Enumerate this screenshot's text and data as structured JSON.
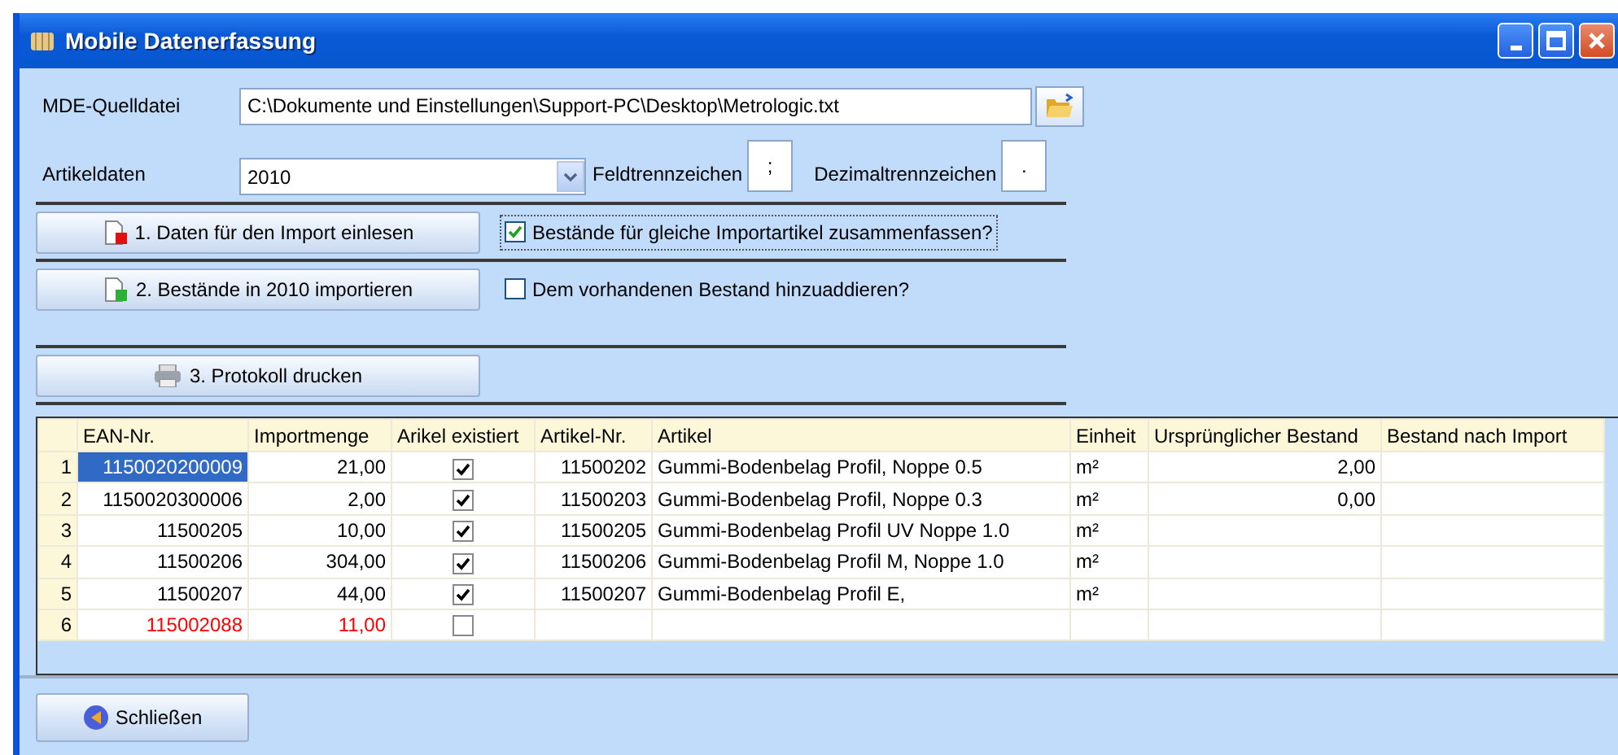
{
  "window": {
    "title": "Mobile Datenerfassung"
  },
  "source_file": {
    "label": "MDE-Quelldatei",
    "value": "C:\\Dokumente und Einstellungen\\Support-PC\\Desktop\\Metrologic.txt"
  },
  "article_data": {
    "label": "Artikeldaten",
    "value": "2010"
  },
  "field_separator": {
    "label": "Feldtrennzeichen",
    "value": ";"
  },
  "decimal_separator": {
    "label": "Dezimaltrennzeichen",
    "value": "."
  },
  "steps": [
    {
      "kind": "read",
      "label": "1. Daten für den Import einlesen",
      "option": {
        "label": "Bestände für gleiche Importartikel zusammenfassen?",
        "checked": true,
        "focused": true
      }
    },
    {
      "kind": "import",
      "label": "2. Bestände in 2010 importieren",
      "option": {
        "label": "Dem vorhandenen Bestand hinzuaddieren?",
        "checked": false,
        "focused": false
      }
    },
    {
      "kind": "print",
      "label": "3. Protokoll drucken"
    }
  ],
  "table": {
    "columns": [
      "EAN-Nr.",
      "Importmenge",
      "Arikel existiert",
      "Artikel-Nr.",
      "Artikel",
      "Einheit",
      "Ursprünglicher Bestand",
      "Bestand nach Import"
    ],
    "rows": [
      {
        "number": "1",
        "ean": "1150020200009",
        "quantity": "21,00",
        "exists": true,
        "article_no": "11500202",
        "article": "Gummi-Bodenbelag Profil, Noppe 0.5",
        "unit": "m²",
        "original_stock": "2,00",
        "selected": true,
        "invalid": false
      },
      {
        "number": "2",
        "ean": "1150020300006",
        "quantity": "2,00",
        "exists": true,
        "article_no": "11500203",
        "article": "Gummi-Bodenbelag Profil, Noppe 0.3",
        "unit": "m²",
        "original_stock": "0,00",
        "selected": false,
        "invalid": false
      },
      {
        "number": "3",
        "ean": "11500205",
        "quantity": "10,00",
        "exists": true,
        "article_no": "11500205",
        "article": "Gummi-Bodenbelag Profil UV Noppe 1.0",
        "unit": "m²",
        "selected": false,
        "invalid": false
      },
      {
        "number": "4",
        "ean": "11500206",
        "quantity": "304,00",
        "exists": true,
        "article_no": "11500206",
        "article": "Gummi-Bodenbelag Profil M, Noppe 1.0",
        "unit": "m²",
        "selected": false,
        "invalid": false
      },
      {
        "number": "5",
        "ean": "11500207",
        "quantity": "44,00",
        "exists": true,
        "article_no": "11500207",
        "article": "Gummi-Bodenbelag Profil E,",
        "unit": "m²",
        "selected": false,
        "invalid": false
      },
      {
        "number": "6",
        "ean": "115002088",
        "quantity": "11,00",
        "exists": false,
        "selected": false,
        "invalid": true
      }
    ]
  },
  "close_button": {
    "label": "Schließen"
  }
}
